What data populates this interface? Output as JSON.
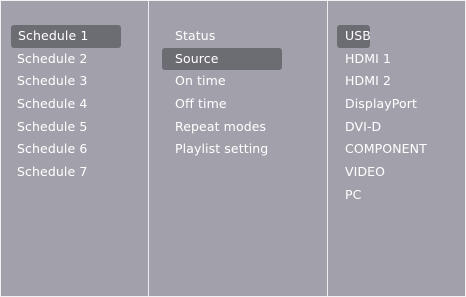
{
  "schedules": {
    "items": [
      "Schedule 1",
      "Schedule 2",
      "Schedule 3",
      "Schedule 4",
      "Schedule 5",
      "Schedule 6",
      "Schedule 7"
    ],
    "selected": "Schedule 1"
  },
  "settings": {
    "items": [
      "Status",
      "Source",
      "On time",
      "Off time",
      "Repeat modes",
      "Playlist setting"
    ],
    "selected": "Source"
  },
  "sources": {
    "items": [
      "USB",
      "HDMI 1",
      "HDMI 2",
      "DisplayPort",
      "DVI-D",
      "COMPONENT",
      "VIDEO",
      "PC"
    ],
    "selected": "USB"
  },
  "colors": {
    "background": "#a2a1ab",
    "highlight": "#6c6c73",
    "text": "#ffffff",
    "border": "#f1f1f4"
  }
}
